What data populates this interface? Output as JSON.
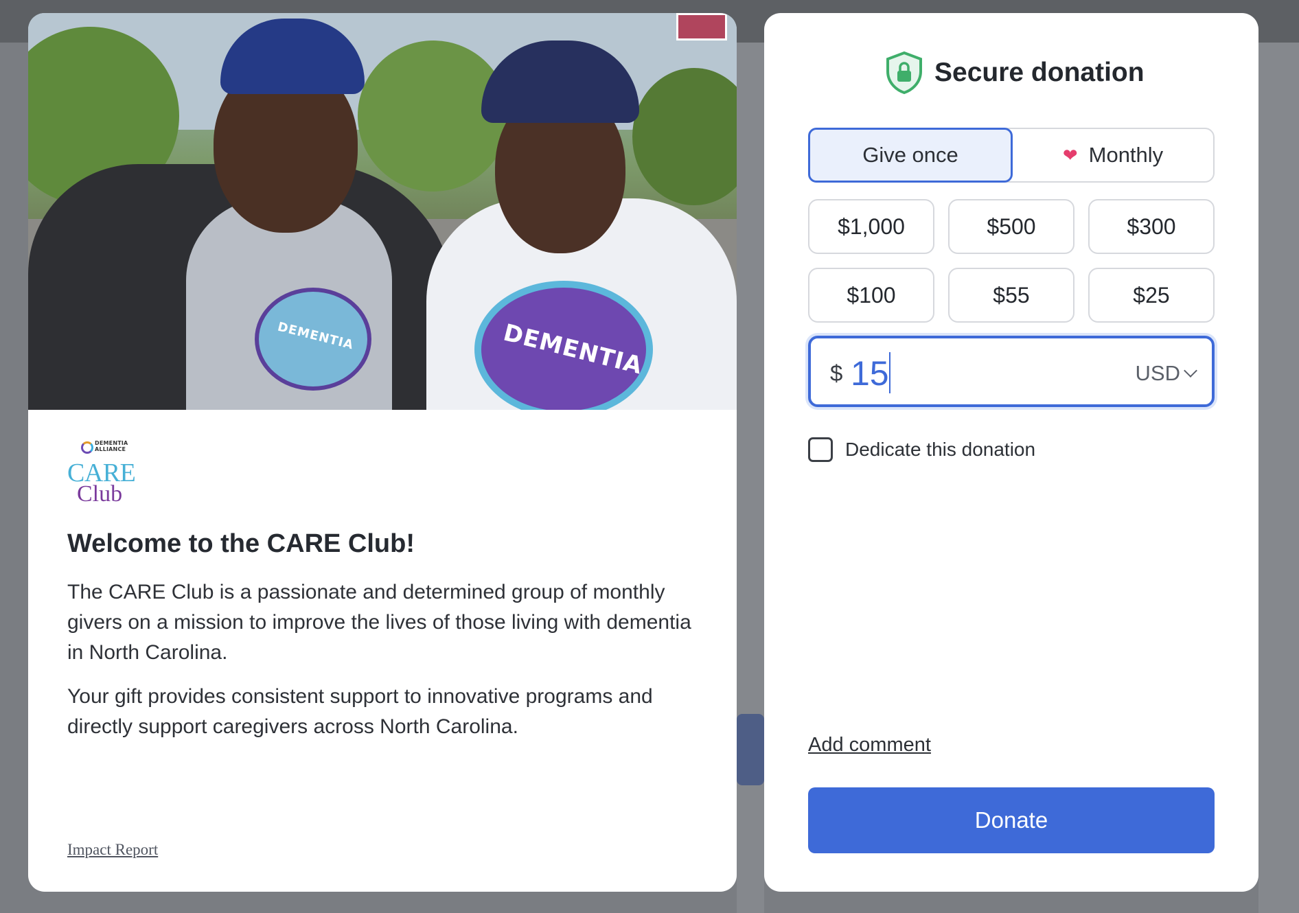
{
  "info": {
    "logo_small_line1": "DEMENTIA",
    "logo_small_line2": "ALLIANCE",
    "logo_care": "CARE",
    "logo_club": "Club",
    "title": "Welcome to the CARE Club!",
    "paragraph1": "The CARE Club is a passionate and determined group of monthly givers on a mission to improve the lives of those living with dementia in North Carolina.",
    "paragraph2": "Your gift provides consistent support to innovative programs and directly support caregivers across North Carolina.",
    "impact_link": "Impact Report",
    "photo_shirt_text": "DEMENTIA"
  },
  "donation": {
    "title": "Secure donation",
    "shield_icon": "shield-lock-icon",
    "frequency": {
      "selected": "Give once",
      "options": [
        {
          "label": "Give once",
          "active": true
        },
        {
          "label": "Monthly",
          "active": false,
          "icon": "heart-icon"
        }
      ]
    },
    "amounts": [
      "$1,000",
      "$500",
      "$300",
      "$100",
      "$55",
      "$25"
    ],
    "custom_amount": {
      "symbol": "$",
      "value": "15",
      "currency": "USD"
    },
    "dedicate_label": "Dedicate this donation",
    "dedicate_checked": false,
    "add_comment": "Add comment",
    "donate_label": "Donate"
  },
  "colors": {
    "accent": "#3e6ad8",
    "heart": "#e53d6d",
    "shield": "#3fae6a",
    "overlay": "#6b6e73"
  }
}
